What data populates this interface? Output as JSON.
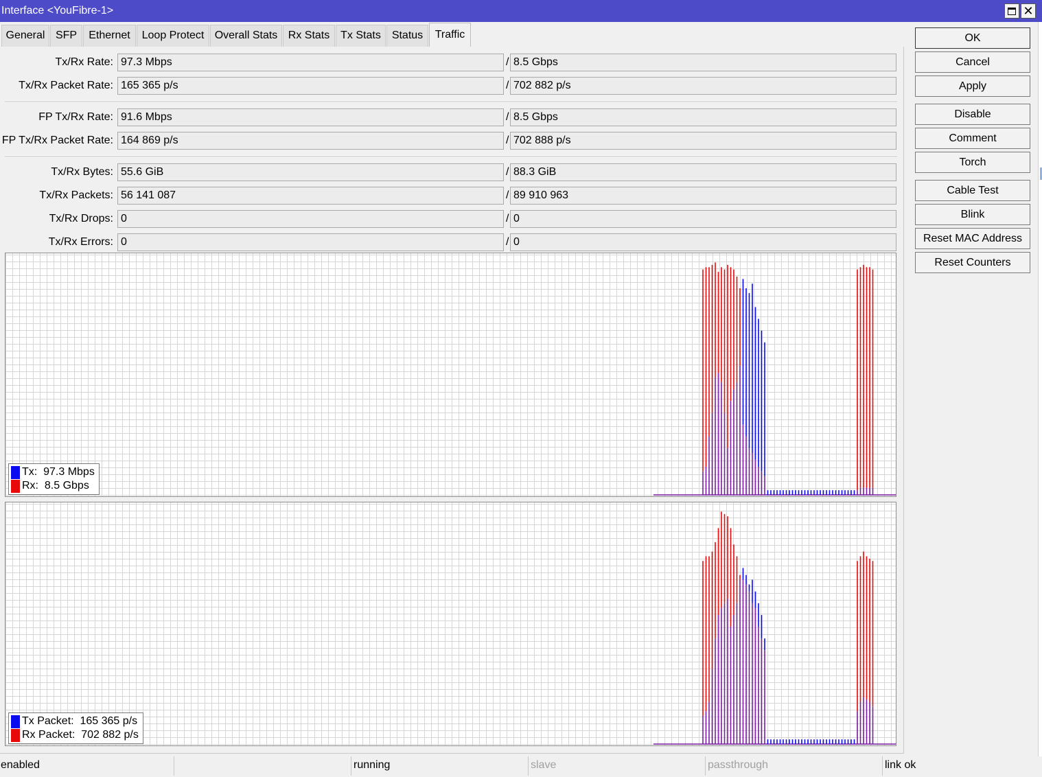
{
  "window": {
    "title": "Interface <YouFibre-1>",
    "maximize_icon": "maximize-icon",
    "close_icon": "close-icon",
    "close_glyph": "✕"
  },
  "tabs": [
    {
      "label": "General"
    },
    {
      "label": "SFP"
    },
    {
      "label": "Ethernet"
    },
    {
      "label": "Loop Protect"
    },
    {
      "label": "Overall Stats"
    },
    {
      "label": "Rx Stats"
    },
    {
      "label": "Tx Stats"
    },
    {
      "label": "Status"
    },
    {
      "label": "Traffic",
      "active": true
    }
  ],
  "stats": {
    "separator": "/",
    "rate": {
      "label": "Tx/Rx Rate:",
      "tx": "97.3 Mbps",
      "rx": "8.5 Gbps"
    },
    "packet_rate": {
      "label": "Tx/Rx Packet Rate:",
      "tx": "165 365 p/s",
      "rx": "702 882 p/s"
    },
    "fp_rate": {
      "label": "FP Tx/Rx Rate:",
      "tx": "91.6 Mbps",
      "rx": "8.5 Gbps"
    },
    "fp_packet_rate": {
      "label": "FP Tx/Rx Packet Rate:",
      "tx": "164 869 p/s",
      "rx": "702 888 p/s"
    },
    "bytes": {
      "label": "Tx/Rx Bytes:",
      "tx": "55.6 GiB",
      "rx": "88.3 GiB"
    },
    "packets": {
      "label": "Tx/Rx Packets:",
      "tx": "56 141 087",
      "rx": "89 910 963"
    },
    "drops": {
      "label": "Tx/Rx Drops:",
      "tx": "0",
      "rx": "0"
    },
    "errors": {
      "label": "Tx/Rx Errors:",
      "tx": "0",
      "rx": "0"
    }
  },
  "traffic_graph": {
    "legend": {
      "tx_label": "Tx:",
      "tx_value": "97.3 Mbps",
      "rx_label": "Rx:",
      "rx_value": "8.5 Gbps"
    }
  },
  "packet_graph": {
    "legend": {
      "tx_label": "Tx Packet:",
      "tx_value": "165 365 p/s",
      "rx_label": "Rx Packet:",
      "rx_value": "702 882 p/s"
    }
  },
  "colors": {
    "tx": "#0a0af0",
    "rx": "#e80a0a",
    "overlap": "#7a1ca0",
    "title_bar": "#4e4bc8",
    "grid": "#d6d6d6"
  },
  "buttons": {
    "ok": "OK",
    "cancel": "Cancel",
    "apply": "Apply",
    "disable": "Disable",
    "comment": "Comment",
    "torch": "Torch",
    "cable_test": "Cable Test",
    "blink": "Blink",
    "reset_mac": "Reset MAC Address",
    "reset_counters": "Reset Counters"
  },
  "status": {
    "enabled": "enabled",
    "empty": "",
    "running": "running",
    "slave": "slave",
    "passthrough": "passthrough",
    "link": "link ok"
  },
  "chart_data": [
    {
      "type": "bar",
      "description_key": "traffic",
      "series": [
        {
          "name": "Tx",
          "values": [
            0,
            0,
            0,
            0,
            0,
            0,
            0,
            0,
            0,
            0,
            0,
            0,
            0,
            0,
            0,
            0,
            10,
            12,
            25,
            35,
            50,
            52,
            48,
            35,
            20,
            40,
            45,
            48,
            55,
            92,
            88,
            86,
            90,
            80,
            75,
            70,
            65,
            2,
            2,
            2,
            2,
            2,
            2,
            2,
            2,
            2,
            2,
            2,
            2,
            2,
            2,
            2,
            2,
            2,
            2,
            2,
            2,
            2,
            2,
            2,
            2,
            2,
            2,
            2,
            2,
            2,
            2,
            3,
            3,
            3,
            3,
            3
          ]
        },
        {
          "name": "Rx",
          "values": [
            0,
            0,
            0,
            0,
            0,
            0,
            0,
            0,
            0,
            0,
            0,
            0,
            0,
            0,
            0,
            0,
            96,
            97,
            97,
            98,
            99,
            95,
            97,
            96,
            98,
            97,
            96,
            93,
            88,
            30,
            25,
            20,
            18,
            15,
            12,
            10,
            8,
            0,
            0,
            0,
            0,
            0,
            0,
            0,
            0,
            0,
            0,
            0,
            0,
            0,
            0,
            0,
            0,
            0,
            0,
            0,
            0,
            0,
            0,
            0,
            0,
            0,
            0,
            0,
            0,
            0,
            96,
            97,
            98,
            97,
            97,
            96
          ]
        }
      ]
    },
    {
      "type": "bar",
      "description_key": "packets",
      "series": [
        {
          "name": "Tx Packet",
          "values": [
            0,
            0,
            0,
            0,
            0,
            0,
            0,
            0,
            0,
            0,
            0,
            0,
            0,
            0,
            0,
            0,
            12,
            14,
            18,
            32,
            45,
            55,
            58,
            60,
            62,
            50,
            55,
            60,
            70,
            75,
            72,
            68,
            70,
            65,
            60,
            55,
            45,
            2,
            2,
            2,
            2,
            2,
            2,
            2,
            2,
            2,
            2,
            2,
            2,
            2,
            2,
            2,
            2,
            2,
            2,
            2,
            2,
            2,
            2,
            2,
            2,
            2,
            2,
            2,
            2,
            2,
            14,
            18,
            20,
            19,
            18,
            16
          ]
        },
        {
          "name": "Rx Packet",
          "values": [
            0,
            0,
            0,
            0,
            0,
            0,
            0,
            0,
            0,
            0,
            0,
            0,
            0,
            0,
            0,
            0,
            78,
            80,
            80,
            82,
            86,
            92,
            99,
            98,
            97,
            92,
            85,
            80,
            72,
            70,
            68,
            65,
            60,
            58,
            50,
            45,
            40,
            0,
            0,
            0,
            0,
            0,
            0,
            0,
            0,
            0,
            0,
            0,
            0,
            0,
            0,
            0,
            0,
            0,
            0,
            0,
            0,
            0,
            0,
            0,
            0,
            0,
            0,
            0,
            0,
            0,
            78,
            80,
            82,
            80,
            79,
            78
          ]
        }
      ]
    }
  ]
}
